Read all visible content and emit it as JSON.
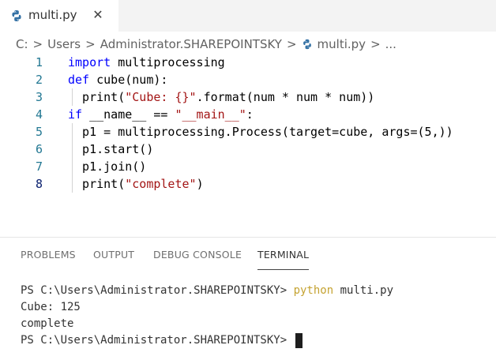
{
  "tab": {
    "label": "multi.py",
    "close": "✕",
    "icon": "python-file-icon"
  },
  "breadcrumb": {
    "parts": [
      "C:",
      "Users",
      "Administrator.SHAREPOINTSKY",
      "multi.py",
      "..."
    ],
    "separator": ">"
  },
  "editor": {
    "lines": [
      {
        "number": "1",
        "tokens": [
          {
            "t": "import",
            "c": "kw"
          },
          {
            "t": " multiprocessing",
            "c": ""
          }
        ]
      },
      {
        "number": "2",
        "tokens": [
          {
            "t": "def",
            "c": "kw"
          },
          {
            "t": " cube(num):",
            "c": ""
          }
        ]
      },
      {
        "number": "3",
        "tokens": [
          {
            "t": "  print(",
            "c": ""
          },
          {
            "t": "\"Cube: {}\"",
            "c": "str"
          },
          {
            "t": ".format(num * num * num))",
            "c": ""
          }
        ]
      },
      {
        "number": "4",
        "tokens": [
          {
            "t": "if",
            "c": "kw"
          },
          {
            "t": " __name__ == ",
            "c": ""
          },
          {
            "t": "\"__main__\"",
            "c": "str"
          },
          {
            "t": ":",
            "c": ""
          }
        ]
      },
      {
        "number": "5",
        "tokens": [
          {
            "t": "  p1 = multiprocessing.Process(target=cube, args=(5,))",
            "c": ""
          }
        ]
      },
      {
        "number": "6",
        "tokens": [
          {
            "t": "  p1.start()",
            "c": ""
          }
        ]
      },
      {
        "number": "7",
        "tokens": [
          {
            "t": "  p1.join()",
            "c": ""
          }
        ]
      },
      {
        "number": "8",
        "tokens": [
          {
            "t": "  print(",
            "c": ""
          },
          {
            "t": "\"complete\"",
            "c": "str"
          },
          {
            "t": ")",
            "c": ""
          }
        ]
      }
    ],
    "active_line": "8"
  },
  "panel": {
    "tabs": [
      "PROBLEMS",
      "OUTPUT",
      "DEBUG CONSOLE",
      "TERMINAL"
    ],
    "active_tab": "TERMINAL"
  },
  "terminal": {
    "prompt1": "PS C:\\Users\\Administrator.SHAREPOINTSKY> ",
    "command": "python",
    "command_args": " multi.py",
    "output1": "Cube: 125",
    "output2": "complete",
    "prompt2": "PS C:\\Users\\Administrator.SHAREPOINTSKY> "
  },
  "colors": {
    "keyword": "#0000ff",
    "string": "#a31515",
    "line_number": "#237893",
    "terminal_command": "#c5a332"
  }
}
